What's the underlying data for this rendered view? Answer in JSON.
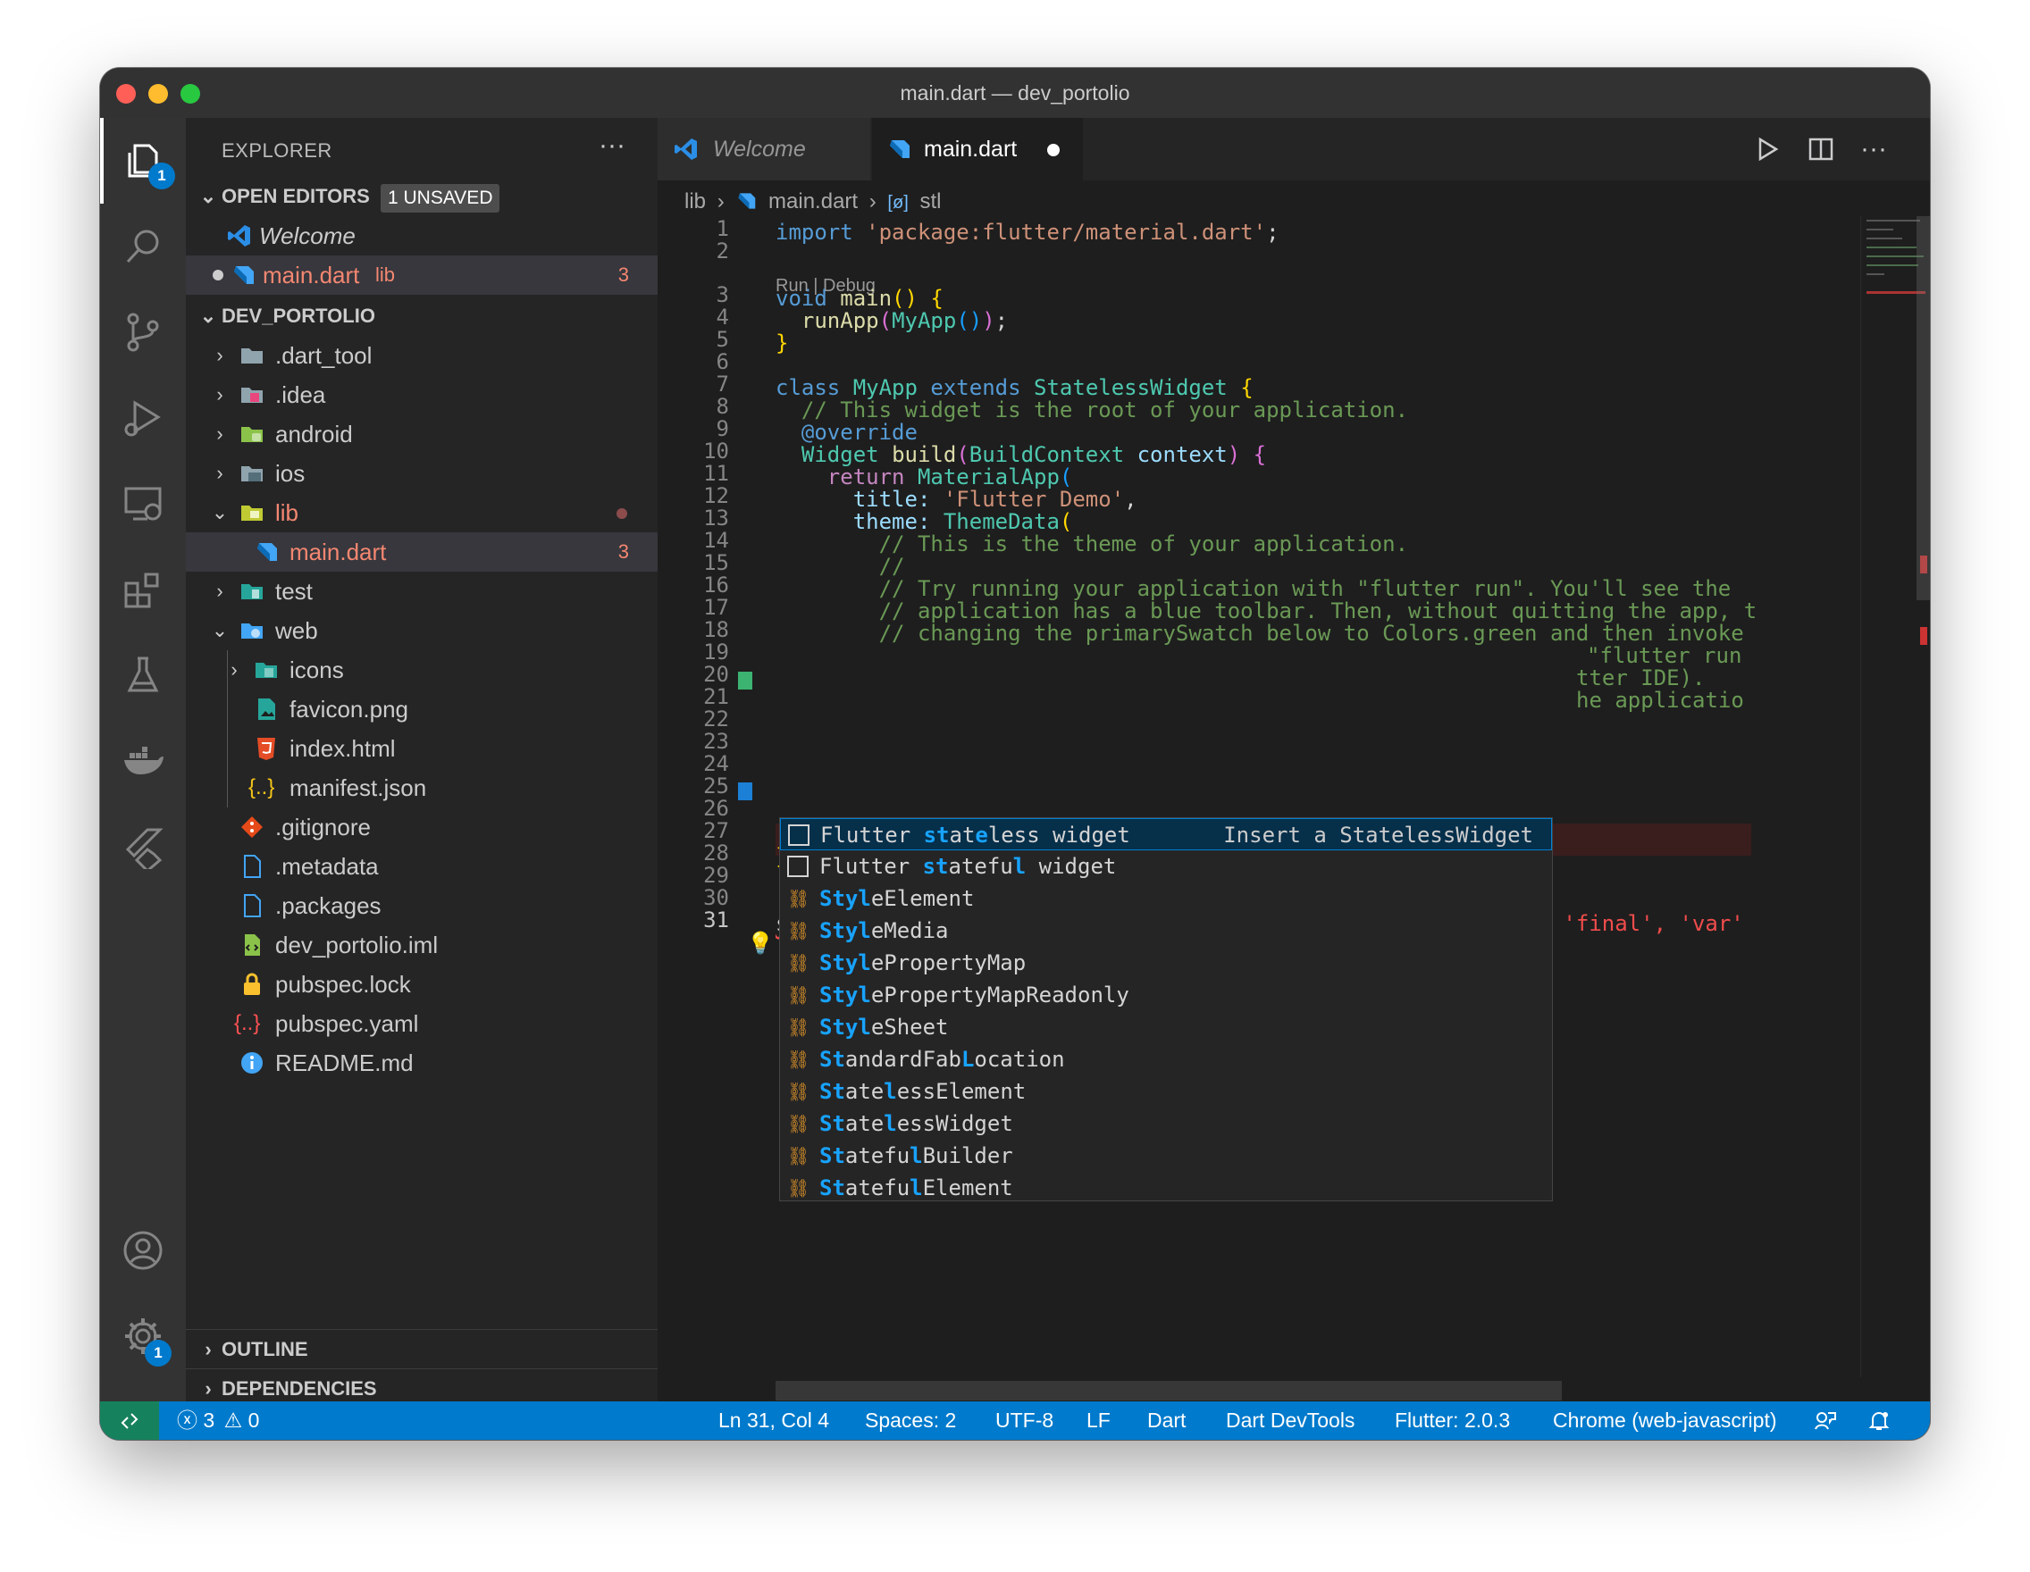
{
  "window": {
    "title": "main.dart — dev_portolio"
  },
  "activity_bar": {
    "explorer_badge": "1",
    "settings_badge": "1"
  },
  "explorer": {
    "title": "EXPLORER",
    "more": "···",
    "open_editors": {
      "label": "OPEN EDITORS",
      "badge": "1 UNSAVED",
      "items": [
        {
          "name": "Welcome"
        },
        {
          "name": "main.dart",
          "folder": "lib",
          "problems": "3"
        }
      ]
    },
    "project": {
      "label": "DEV_PORTOLIO",
      "items": [
        {
          "name": ".dart_tool"
        },
        {
          "name": ".idea"
        },
        {
          "name": "android"
        },
        {
          "name": "ios"
        },
        {
          "name": "lib"
        },
        {
          "name": "main.dart",
          "problems": "3"
        },
        {
          "name": "test"
        },
        {
          "name": "web"
        },
        {
          "name": "icons"
        },
        {
          "name": "favicon.png"
        },
        {
          "name": "index.html"
        },
        {
          "name": "manifest.json"
        },
        {
          "name": ".gitignore"
        },
        {
          "name": ".metadata"
        },
        {
          "name": ".packages"
        },
        {
          "name": "dev_portolio.iml"
        },
        {
          "name": "pubspec.lock"
        },
        {
          "name": "pubspec.yaml"
        },
        {
          "name": "README.md"
        }
      ]
    },
    "outline_label": "OUTLINE",
    "dependencies_label": "DEPENDENCIES"
  },
  "tabs": [
    {
      "label": "Welcome"
    },
    {
      "label": "main.dart"
    }
  ],
  "breadcrumb": {
    "folder": "lib",
    "file": "main.dart",
    "symbol": "stl"
  },
  "code": {
    "codelens": "Run | Debug",
    "line_numbers": [
      "1",
      "2",
      "3",
      "4",
      "5",
      "6",
      "7",
      "8",
      "9",
      "10",
      "11",
      "12",
      "13",
      "14",
      "15",
      "16",
      "17",
      "18",
      "19",
      "20",
      "21",
      "22",
      "23",
      "24",
      "25",
      "26",
      "27",
      "28",
      "29",
      "30",
      "31"
    ],
    "lines": {
      "l1_kw": "import",
      "l1_str": "'package:flutter/material.dart'",
      "l1_end": ";",
      "l3_kw": "void",
      "l3_fn": "main",
      "l4_fn": "runApp",
      "l4_type": "MyApp",
      "l7_kw1": "class",
      "l7_type1": "MyApp",
      "l7_kw2": "extends",
      "l7_type2": "StatelessWidget",
      "l8": "// This widget is the root of your application.",
      "l9": "@override",
      "l10_type": "Widget",
      "l10_fn": "build",
      "l10_type2": "BuildContext",
      "l10_var": "context",
      "l11_kw": "return",
      "l11_type": "MaterialApp",
      "l12_var": "title:",
      "l12_str": "'Flutter Demo'",
      "l13_var": "theme:",
      "l13_type": "ThemeData",
      "l14": "// This is the theme of your application.",
      "l15": "//",
      "l16": "// Try running your application with \"flutter run\". You'll see the",
      "l17": "// application has a blue toolbar. Then, without quitting the app, t",
      "l18": "// changing the primarySwatch below to Colors.green and then invoke",
      "l19_tail": "\"flutter run",
      "l20_tail": "tter IDE).",
      "l21_tail": "he applicatio",
      "l31_code": "stl",
      "l31_error": "Variables must be declared using the keywords 'const', 'final', 'var'"
    }
  },
  "suggest": {
    "items": [
      {
        "pre": "Flutter ",
        "hl1": "st",
        "mid1": "at",
        "hl2": "e",
        "rest": "less widget",
        "detail": "Insert a StatelessWidget"
      },
      {
        "pre": "Flutter ",
        "hl1": "st",
        "mid1": "atefu",
        "hl2": "l",
        "rest": " widget"
      },
      {
        "pre": "",
        "hl1": "Sty",
        "mid1": "",
        "hl2": "l",
        "rest": "eElement"
      },
      {
        "pre": "",
        "hl1": "Sty",
        "mid1": "",
        "hl2": "l",
        "rest": "eMedia"
      },
      {
        "pre": "",
        "hl1": "Sty",
        "mid1": "",
        "hl2": "l",
        "rest": "ePropertyMap"
      },
      {
        "pre": "",
        "hl1": "Sty",
        "mid1": "",
        "hl2": "l",
        "rest": "ePropertyMapReadonly"
      },
      {
        "pre": "",
        "hl1": "Sty",
        "mid1": "",
        "hl2": "l",
        "rest": "eSheet"
      },
      {
        "pre": "",
        "hl1": "St",
        "mid1": "andardFab",
        "hl2": "L",
        "rest": "ocation"
      },
      {
        "pre": "",
        "hl1": "St",
        "mid1": "ate",
        "hl2": "l",
        "rest": "essElement"
      },
      {
        "pre": "",
        "hl1": "St",
        "mid1": "ate",
        "hl2": "l",
        "rest": "essWidget"
      },
      {
        "pre": "",
        "hl1": "St",
        "mid1": "atefu",
        "hl2": "l",
        "rest": "Builder"
      },
      {
        "pre": "",
        "hl1": "St",
        "mid1": "atefu",
        "hl2": "l",
        "rest": "Element"
      }
    ]
  },
  "statusbar": {
    "errors": "3",
    "warnings": "0",
    "position": "Ln 31, Col 4",
    "spaces": "Spaces: 2",
    "encoding": "UTF-8",
    "eol": "LF",
    "language": "Dart",
    "devtools": "Dart DevTools",
    "flutter": "Flutter: 2.0.3",
    "device": "Chrome (web-javascript)"
  },
  "colors": {
    "accent": "#007acc",
    "remote": "#16825d",
    "error": "#f14c4c"
  }
}
